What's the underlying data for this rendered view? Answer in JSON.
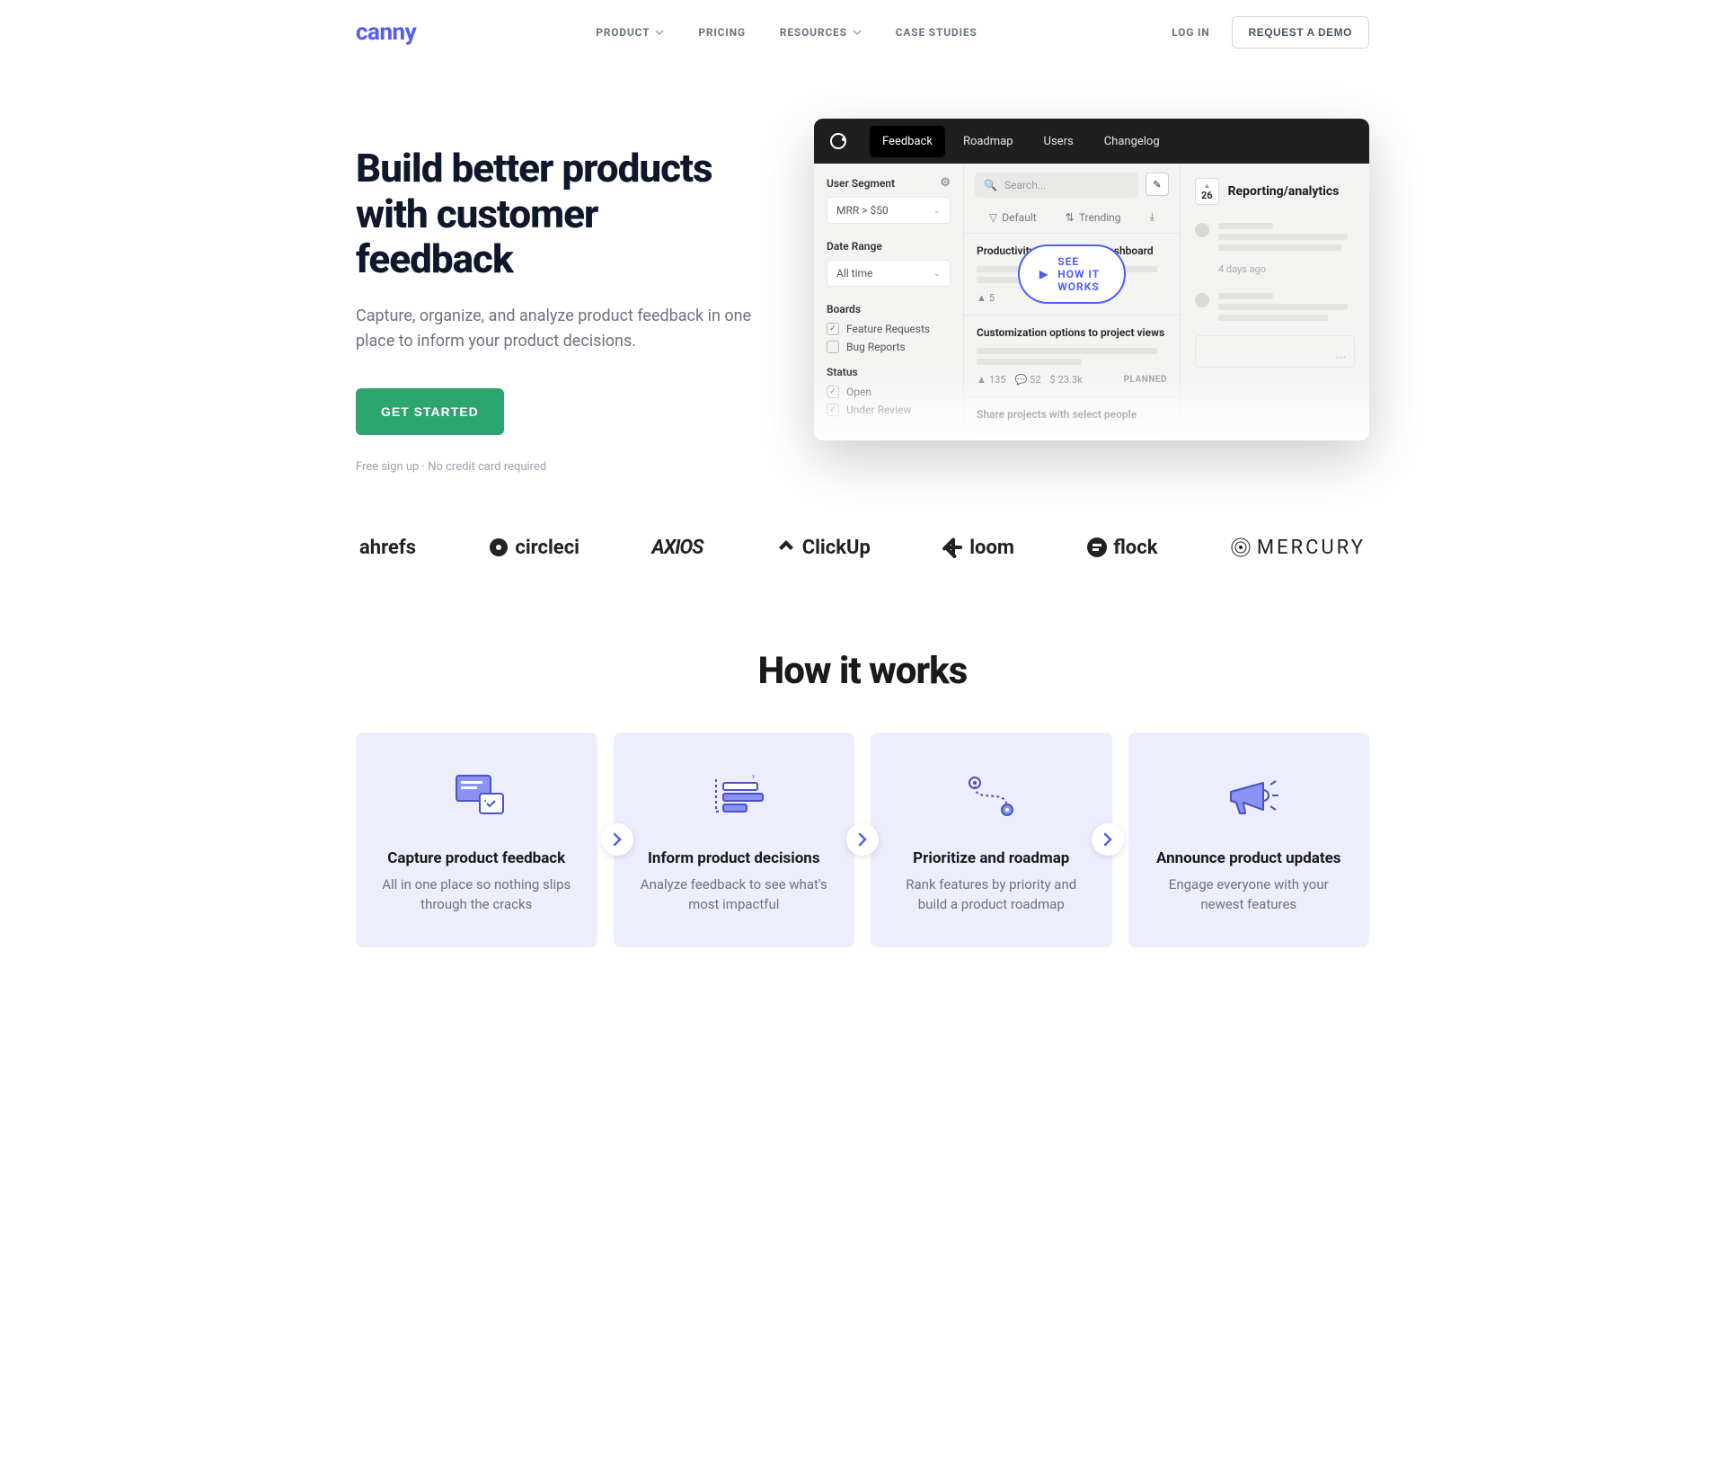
{
  "nav": {
    "logo": "canny",
    "items": [
      "PRODUCT",
      "PRICING",
      "RESOURCES",
      "CASE STUDIES"
    ],
    "login": "LOG IN",
    "demo": "REQUEST A DEMO"
  },
  "hero": {
    "title": "Build better products with customer feedback",
    "sub": "Capture, organize, and analyze product feedback in one place to inform your product decisions.",
    "cta": "GET STARTED",
    "foot": "Free sign up · No credit card required"
  },
  "app": {
    "tabs": [
      "Feedback",
      "Roadmap",
      "Users",
      "Changelog"
    ],
    "segmentLabel": "User Segment",
    "segmentValue": "MRR > $50",
    "dateLabel": "Date Range",
    "dateValue": "All time",
    "boardsLabel": "Boards",
    "boards": [
      "Feature Requests",
      "Bug Reports"
    ],
    "statusLabel": "Status",
    "statuses": [
      "Open",
      "Under Review"
    ],
    "searchPlaceholder": "Search...",
    "sortDefault": "Default",
    "sortTrending": "Trending",
    "items": [
      {
        "title": "Productivity widget in the dashboard",
        "up": "5"
      },
      {
        "title": "Customization options to project views",
        "up": "135",
        "comments": "52",
        "amount": "23.3k",
        "status": "PLANNED"
      },
      {
        "title": "Share projects with select people"
      }
    ],
    "cta": "SEE HOW IT WORKS",
    "detailUp": "26",
    "detailTitle": "Reporting/analytics",
    "detailDate": "4 days ago"
  },
  "logos": [
    "ahrefs",
    "circleci",
    "AXIOS",
    "ClickUp",
    "loom",
    "flock",
    "MERCURY"
  ],
  "hiw": {
    "title": "How it works",
    "cards": [
      {
        "title": "Capture product feedback",
        "sub": "All in one place so nothing slips through the cracks"
      },
      {
        "title": "Inform product decisions",
        "sub": "Analyze feedback to see what's most impactful"
      },
      {
        "title": "Prioritize and roadmap",
        "sub": "Rank features by priority and build a product roadmap"
      },
      {
        "title": "Announce product updates",
        "sub": "Engage everyone with your newest features"
      }
    ]
  }
}
